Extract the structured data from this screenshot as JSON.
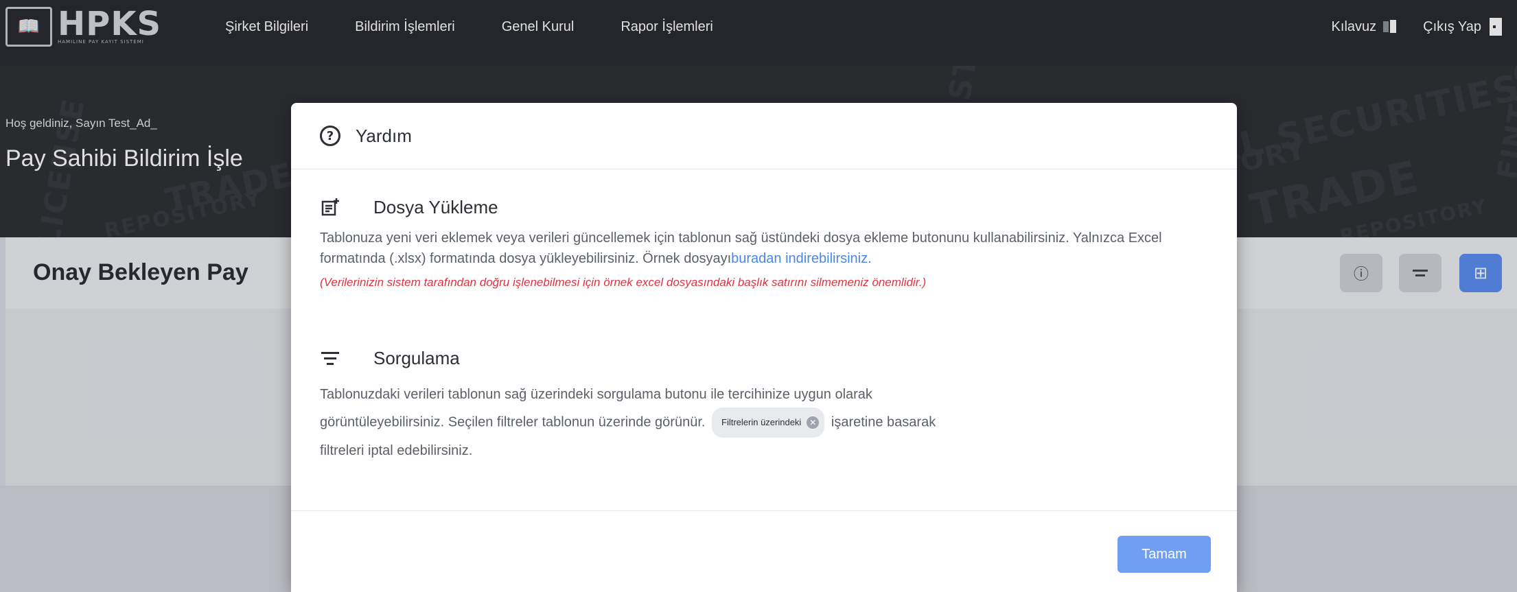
{
  "app": {
    "logo_text": "HPKS",
    "logo_subtitle": "HAMILINE PAY KAYIT SISTEMI"
  },
  "nav": {
    "items": [
      {
        "label": "Şirket Bilgileri"
      },
      {
        "label": "Bildirim İşlemleri"
      },
      {
        "label": "Genel Kurul"
      },
      {
        "label": "Rapor İşlemleri"
      }
    ],
    "guide_label": "Kılavuz",
    "logout_label": "Çıkış Yap"
  },
  "hero": {
    "welcome": "Hoş geldiniz, Sayın Test_Ad_",
    "title": "Pay Sahibi Bildirim İşle",
    "watermarks": [
      "CENTRAL SECURITIES",
      "DEPOSITORY",
      "TRADE",
      "REPOSITORY",
      "REGISTRY",
      "FINTECH",
      "LICENSE"
    ]
  },
  "panel": {
    "title": "Onay Bekleyen Pay"
  },
  "modal": {
    "title": "Yardım",
    "upload": {
      "title": "Dosya Yükleme",
      "text_before_link": "Tablonuza yeni veri eklemek veya verileri güncellemek için tablonun sağ üstündeki dosya ekleme butonunu kullanabilirsiniz. Yalnızca Excel formatında (.xlsx) formatında dosya yükleyebilirsiniz. Örnek dosyayı",
      "link_text": "buradan indirebilirsiniz.",
      "warning": "(Verilerinizin sistem tarafından doğru işlenebilmesi için örnek excel dosyasındaki başlık satırını silmemeniz önemlidir.)"
    },
    "query": {
      "title": "Sorgulama",
      "line1": "Tablonuzdaki verileri tablonun sağ üzerindeki sorgulama butonu ile tercihinize uygun olarak",
      "line2_before_chip": "görüntüleyebilirsiniz. Seçilen filtreler tablonun üzerinde görünür.",
      "chip_label": "Filtrelerin üzerindeki",
      "line2_after_chip": "işaretine basarak",
      "line3": "filtreleri iptal edebilirsiniz."
    },
    "ok_label": "Tamam"
  },
  "colors": {
    "accent": "#5c8ff2",
    "warning": "#e0323e",
    "link": "#4a86e8",
    "topbar": "#2a2c31"
  }
}
